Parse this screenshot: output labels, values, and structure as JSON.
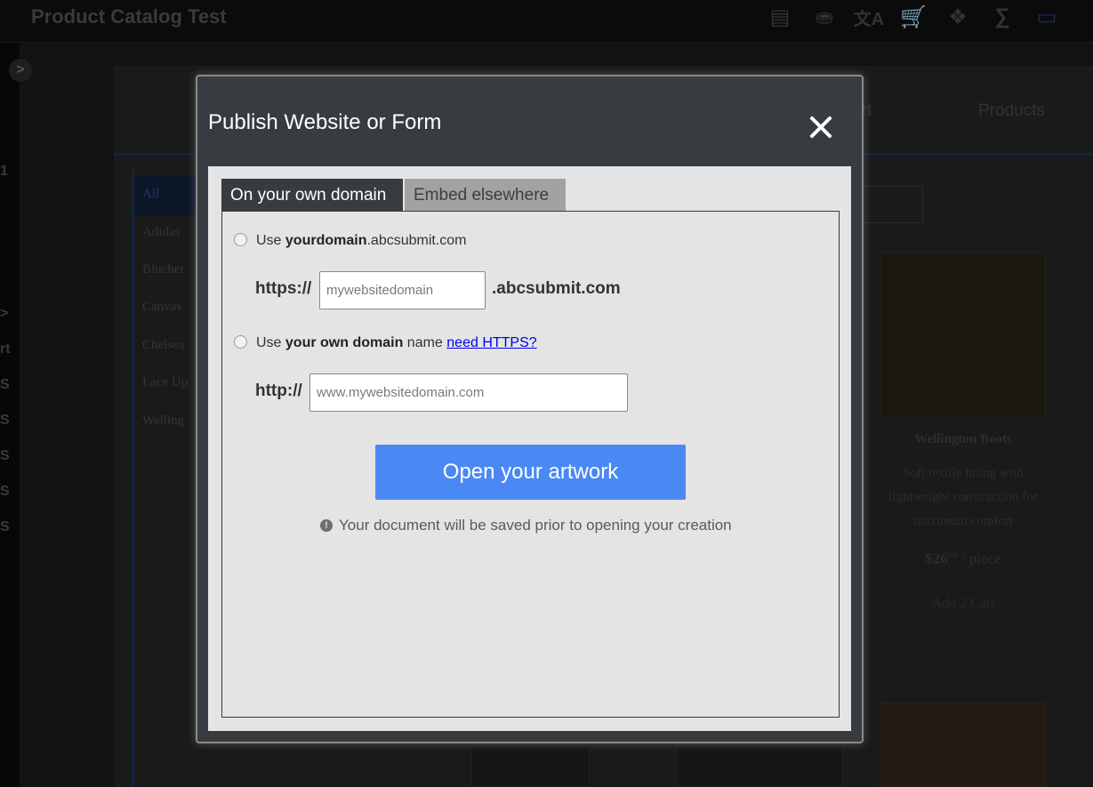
{
  "app": {
    "title": "Product Catalog Test",
    "toolbar_icons": [
      "layout-icon",
      "database-icon",
      "translate-icon",
      "cart-icon",
      "puzzle-icon",
      "formula-icon",
      "monitor-icon"
    ],
    "rail_letters": [
      "1",
      ">",
      "rt",
      "S",
      "S",
      "S",
      "S",
      "S"
    ]
  },
  "page": {
    "nav": {
      "cart": "art",
      "products": "Products"
    },
    "categories": [
      "All",
      "Adidas",
      "Blucher",
      "Canvas",
      "Chelsea",
      "Lace Up",
      "Welling"
    ],
    "product": {
      "name": "Wellington Boots",
      "description": "Soft textile lining with lightweight construction for maximum comfort",
      "price_whole": "$26",
      "price_cents": "50",
      "price_unit": " / piece",
      "add_to_cart": "Add 2 Cart"
    }
  },
  "modal": {
    "title": "Publish Website or Form",
    "tabs": [
      {
        "label": "On your own domain",
        "active": true
      },
      {
        "label": "Embed elsewhere",
        "active": false
      }
    ],
    "option1": {
      "prefix": "Use ",
      "bold": "yourdomain",
      "suffix": ".abcsubmit.com",
      "protocol": "https://",
      "placeholder": "mywebsitedomain",
      "domain_suffix": ".abcsubmit.com"
    },
    "option2": {
      "prefix": "Use ",
      "bold": "your own domain",
      "suffix": " name ",
      "link": "need HTTPS?",
      "protocol": "http://",
      "placeholder": "www.mywebsitedomain.com"
    },
    "primary_button": "Open your artwork",
    "notice": "Your document will be saved prior to opening your creation",
    "notice_icon": "!"
  },
  "colors": {
    "modal_header": "#373c40",
    "modal_body": "#e4e4e4",
    "primary": "#4a89f3",
    "link": "#0000ee"
  }
}
